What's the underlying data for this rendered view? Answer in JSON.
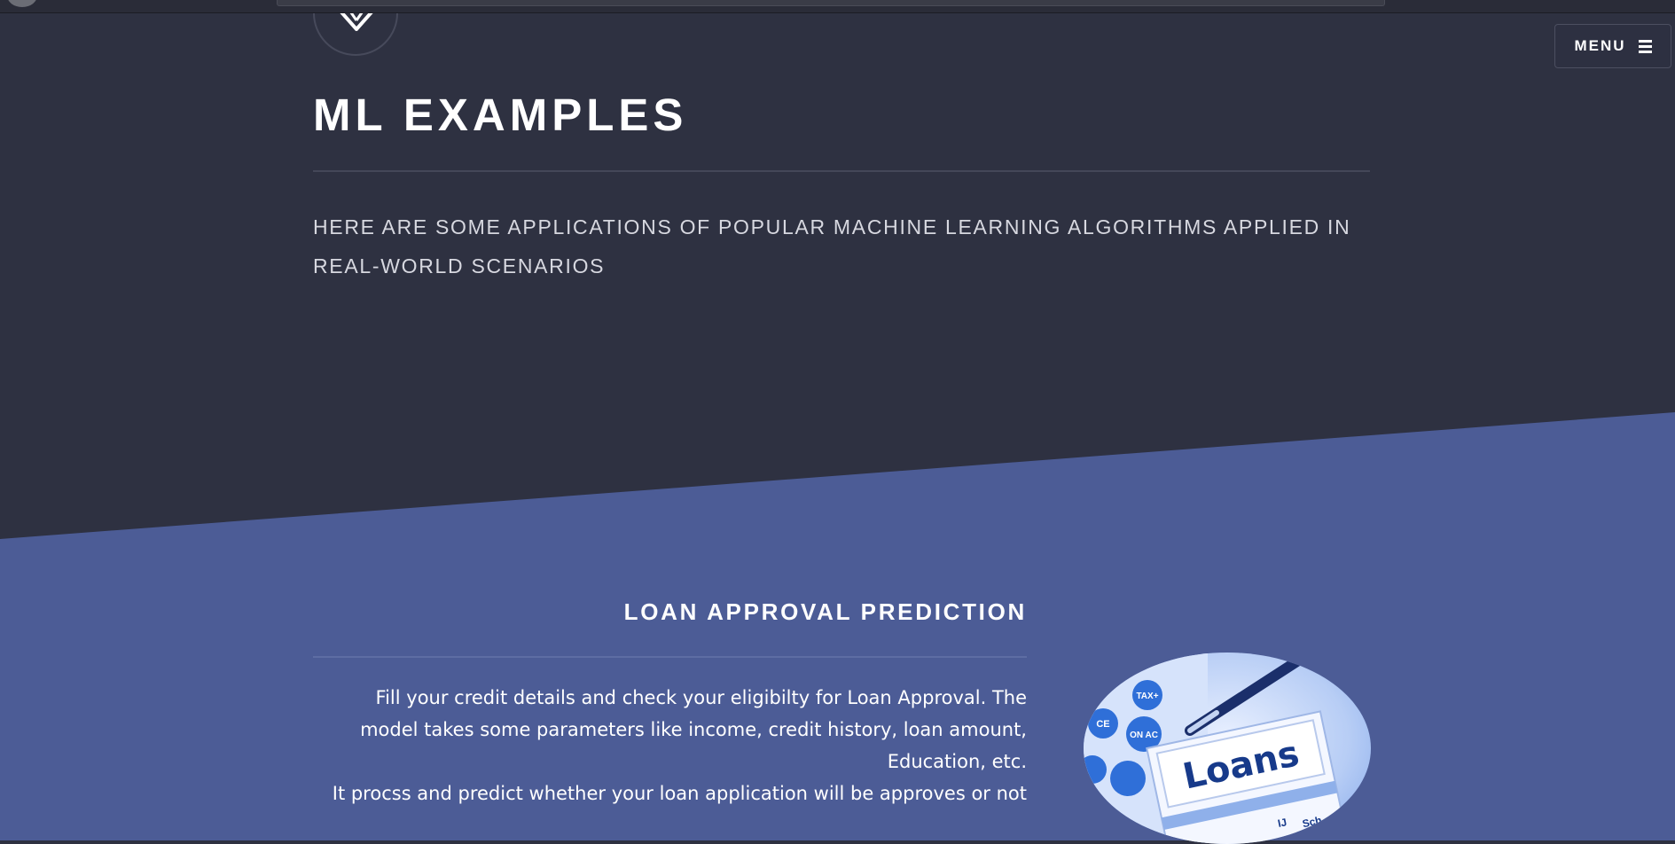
{
  "header": {
    "title": "ML EXAMPLES",
    "subtitle": "HERE ARE SOME APPLICATIONS OF POPULAR MACHINE LEARNING ALGORITHMS APPLIED IN REAL-WORLD SCENARIOS",
    "logo_icon": "diamond-icon"
  },
  "nav": {
    "menu_label": "MENU",
    "menu_icon": "hamburger-icon"
  },
  "section": {
    "title": "LOAN APPROVAL PREDICTION",
    "description_line1": "Fill your credit details and check your eligibilty for Loan Approval. The model takes some parameters like income, credit history, loan amount, Education, etc.",
    "description_line2": "It procss and predict whether your loan application will be approves or not",
    "image": {
      "text": "Loans",
      "calculator_keys": [
        "TAX+",
        "ON AC",
        "CE"
      ],
      "tab_labels": [
        "IJ",
        "Sch"
      ]
    }
  },
  "colors": {
    "header_bg": "#2e3141",
    "section_bg": "#4c5c96",
    "text": "#ffffff"
  }
}
